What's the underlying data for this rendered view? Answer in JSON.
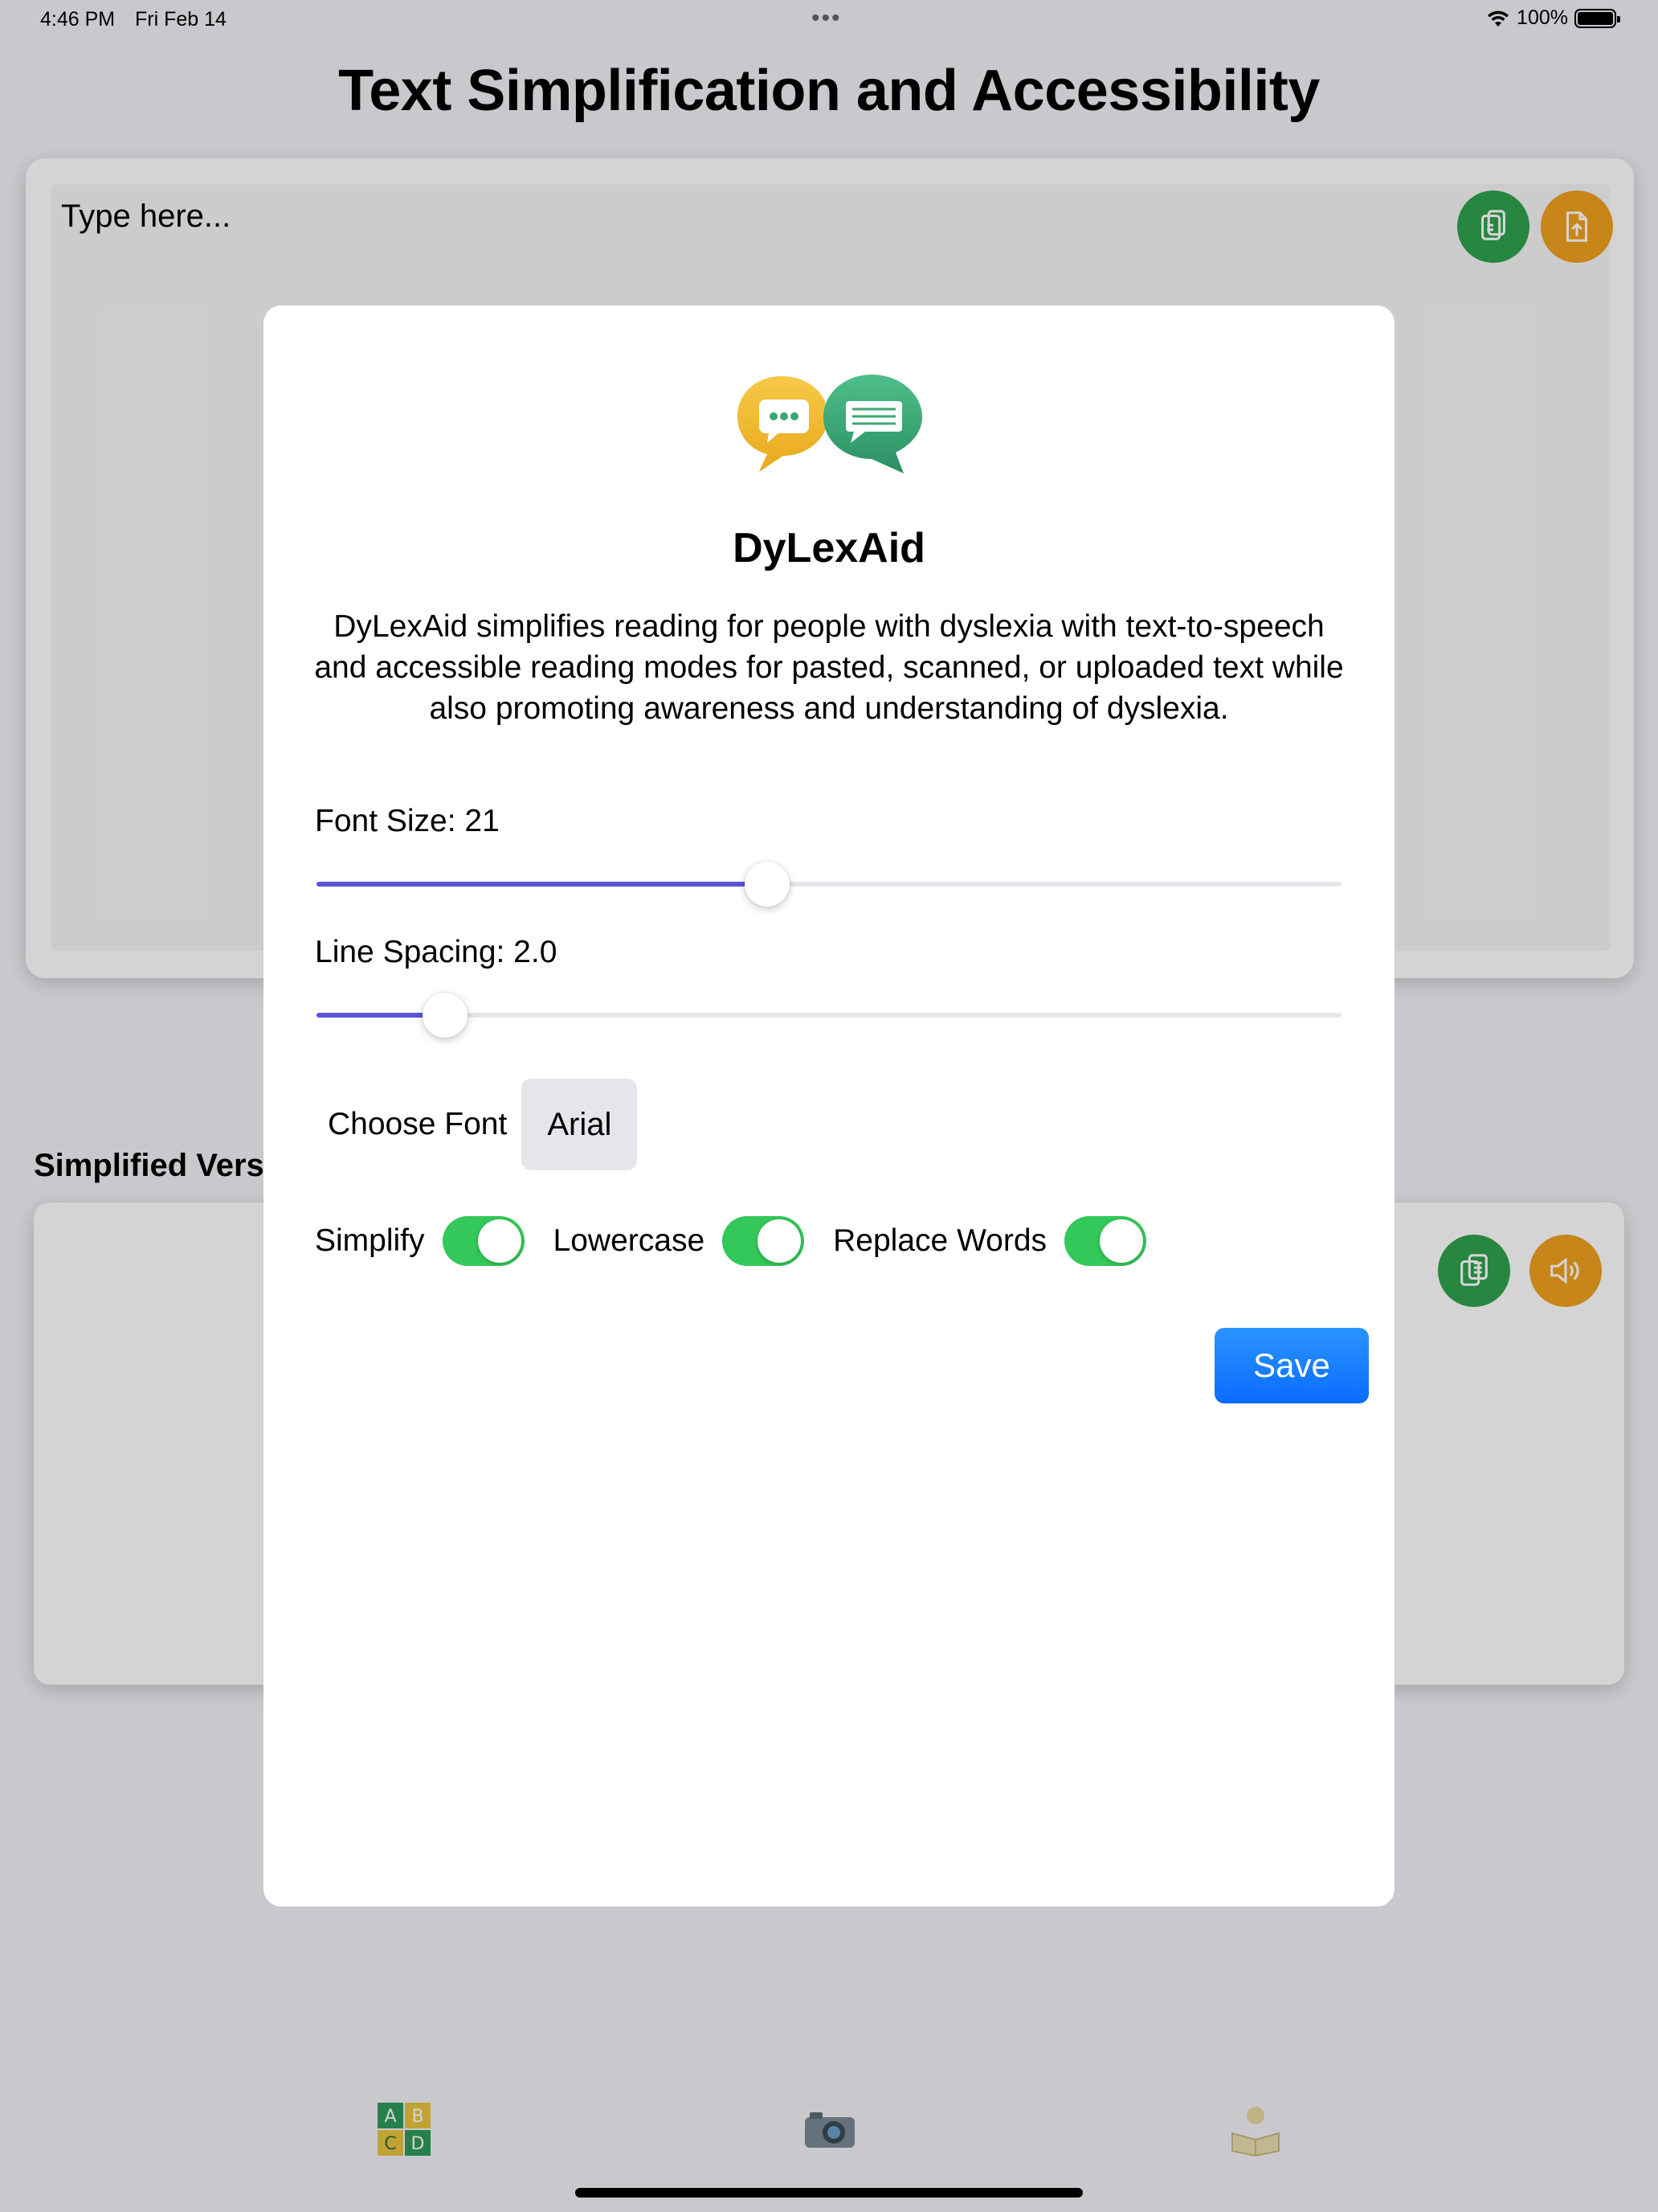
{
  "status_bar": {
    "time": "4:46 PM",
    "date": "Fri Feb 14",
    "battery": "100%"
  },
  "page": {
    "title": "Text Simplification and Accessibility",
    "input_placeholder": "Type here...",
    "simplified_label": "Simplified Version"
  },
  "modal": {
    "app_name": "DyLexAid",
    "description": "DyLexAid simplifies reading for people with dyslexia with text-to-speech and accessible reading modes for pasted, scanned, or uploaded text while also promoting awareness and understanding of dyslexia.",
    "font_size": {
      "label": "Font Size: 21",
      "value_fraction": 0.44
    },
    "line_spacing": {
      "label": "Line Spacing: 2.0",
      "value_fraction": 0.125
    },
    "choose_font_label": "Choose Font",
    "selected_font": "Arial",
    "toggles": [
      {
        "label": "Simplify",
        "on": true
      },
      {
        "label": "Lowercase",
        "on": true
      },
      {
        "label": "Replace Words",
        "on": true
      }
    ],
    "save_label": "Save"
  },
  "icons": {
    "paste": "paste-icon",
    "upload": "upload-file-icon",
    "copy": "copy-icon",
    "speaker": "speaker-icon",
    "tab_alphabet": "alphabet-blocks-icon",
    "tab_camera": "camera-icon",
    "tab_reading": "reading-person-icon"
  },
  "colors": {
    "accent_green": "#34c759",
    "accent_orange": "#f0a020",
    "slider_fill": "#5856d6",
    "save_blue": "#0a7aff"
  }
}
